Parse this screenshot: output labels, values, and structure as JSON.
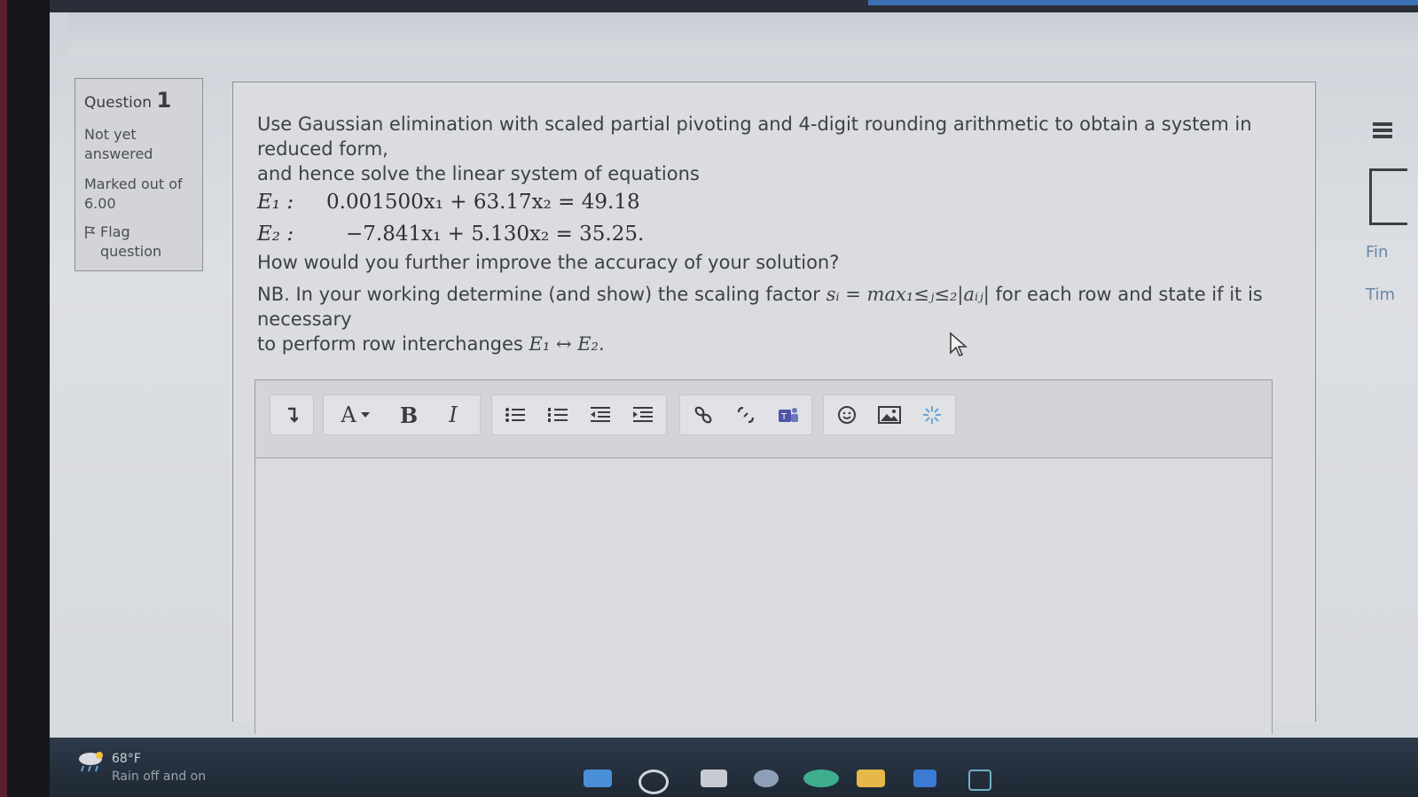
{
  "question_info": {
    "label": "Question",
    "number": "1",
    "status": [
      "Not yet",
      "answered"
    ],
    "marks": [
      "Marked out of",
      "6.00"
    ],
    "flag": [
      "Flag",
      "question"
    ]
  },
  "question": {
    "intro_line1": "Use Gaussian elimination with scaled partial pivoting and 4-digit rounding arithmetic to obtain a system in reduced form,",
    "intro_line2": "and hence solve the linear system of equations",
    "eq1_label": "E₁ :",
    "eq1": "0.001500x₁ + 63.17x₂ = 49.18",
    "eq2_label": "E₂ :",
    "eq2": "−7.841x₁ + 5.130x₂ = 35.25.",
    "followup": "How would you further improve the accuracy of your solution?",
    "nb_prefix": "NB. In your working determine (and show) the scaling factor ",
    "nb_formula": "sᵢ = max₁≤ⱼ≤₂|aᵢⱼ|",
    "nb_suffix": " for each row and state if it is necessary",
    "nb_line2_prefix": "to perform row interchanges ",
    "nb_line2_formula": "E₁ ↔ E₂",
    "nb_line2_suffix": "."
  },
  "toolbar": {
    "font_color": "A",
    "bold": "B",
    "italic": "I"
  },
  "right_panel": {
    "finish_label": "Fin",
    "time_label": "Tim"
  },
  "weather": {
    "temp": "68°F",
    "desc": "Rain off and on"
  },
  "colors": {
    "link": "#6a86a8",
    "text": "#3d4045",
    "taskbar": "#1f2834"
  }
}
